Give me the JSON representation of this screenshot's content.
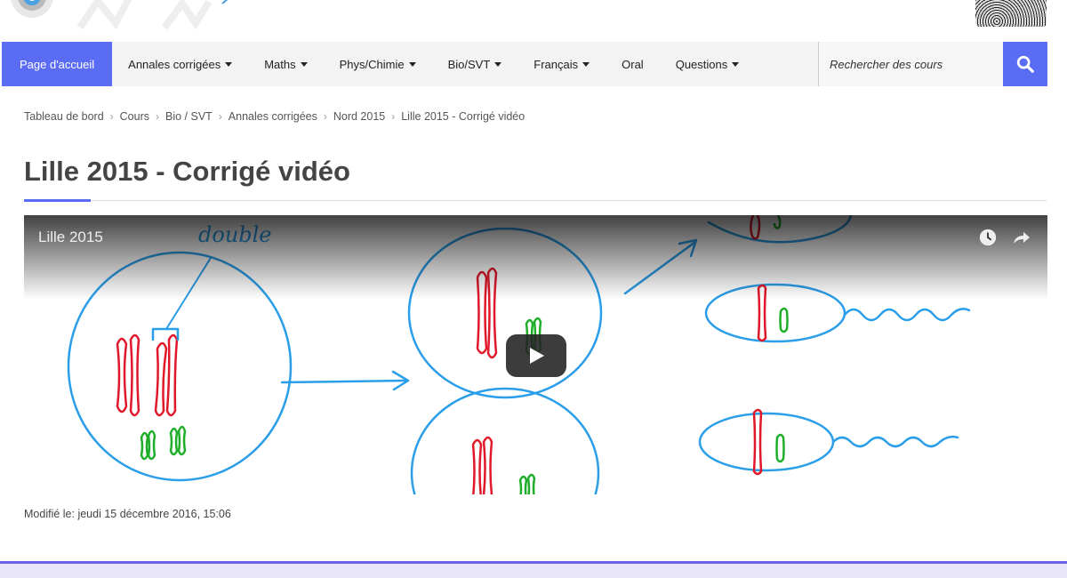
{
  "nav": {
    "home": "Page d'accueil",
    "items": [
      "Annales corrigées",
      "Maths",
      "Phys/Chimie",
      "Bio/SVT",
      "Français",
      "Oral",
      "Questions"
    ],
    "search_placeholder": "Rechercher des cours"
  },
  "breadcrumb": [
    "Tableau de bord",
    "Cours",
    "Bio / SVT",
    "Annales corrigées",
    "Nord 2015",
    "Lille 2015 - Corrigé vidéo"
  ],
  "page": {
    "title": "Lille 2015 - Corrigé vidéo",
    "modified": "Modifié le: jeudi 15 décembre 2016, 15:06"
  },
  "video": {
    "title": "Lille 2015",
    "annotation": "double"
  },
  "colors": {
    "accent": "#5a6cf4",
    "cell_outline": "#2a9ee8",
    "chromosome_red": "#e0182a",
    "chromosome_green": "#1fae2a"
  }
}
